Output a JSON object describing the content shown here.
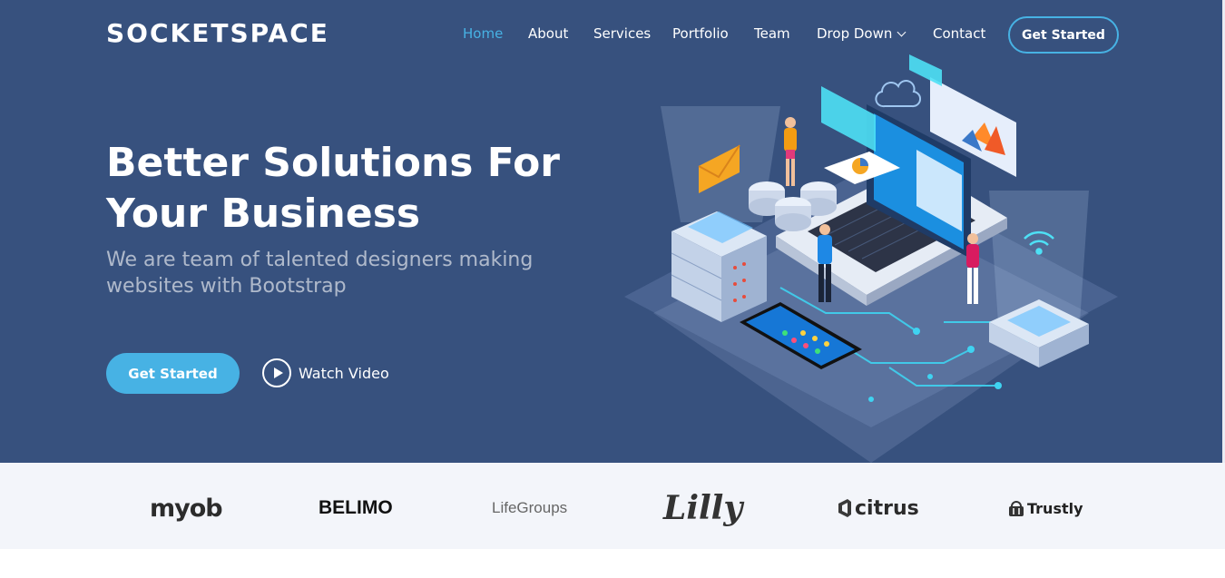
{
  "brand": {
    "logo": "SOCKETSPACE"
  },
  "nav": {
    "items": [
      {
        "label": "Home",
        "active": true
      },
      {
        "label": "About",
        "active": false
      },
      {
        "label": "Services",
        "active": false
      },
      {
        "label": "Portfolio",
        "active": false
      },
      {
        "label": "Team",
        "active": false
      },
      {
        "label": "Drop Down",
        "active": false,
        "has_dropdown": true
      },
      {
        "label": "Contact",
        "active": false
      }
    ],
    "cta_label": "Get Started"
  },
  "hero": {
    "title": "Better Solutions For Your Business",
    "subtitle": "We are team of talented designers making websites with Bootstrap",
    "primary_button": "Get Started",
    "video_button": "Watch Video",
    "illustration_icon": "isometric-tech-illustration-icon"
  },
  "clients": {
    "logos": [
      {
        "name": "myob",
        "icon": "myob-logo-icon"
      },
      {
        "name": "BELIMO",
        "icon": "belimo-logo-icon"
      },
      {
        "name": "LifeGroups",
        "icon": "lifegroups-logo-icon"
      },
      {
        "name": "Lilly",
        "icon": "lilly-logo-icon"
      },
      {
        "name": "citrus",
        "icon": "citrus-logo-icon"
      },
      {
        "name": "Trustly",
        "icon": "trustly-logo-icon"
      }
    ]
  },
  "colors": {
    "hero_bg": "#37517e",
    "accent": "#47b2e4",
    "clients_bg": "#f3f5fa"
  }
}
